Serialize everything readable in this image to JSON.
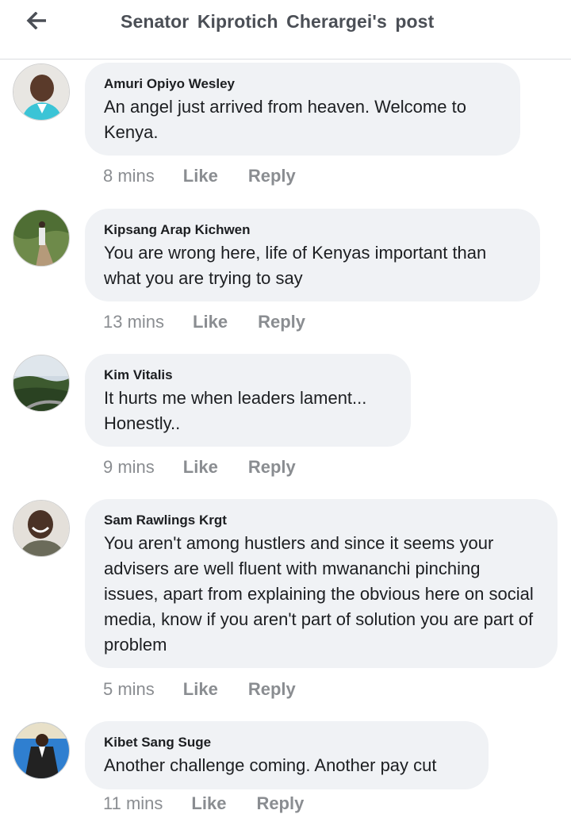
{
  "header": {
    "title": "Senator  Kiprotich  Cherargei's post",
    "back_icon": "back-arrow-icon"
  },
  "comments": [
    {
      "author": "Amuri Opiyo Wesley",
      "text": "An angel just arrived from heaven. Welcome to Kenya.",
      "time": "8 mins",
      "like": "Like",
      "reply": "Reply"
    },
    {
      "author": "Kipsang Arap Kichwen",
      "text": "You are wrong here, life of Kenyas important than what you are trying to say",
      "time": "13 mins",
      "like": "Like",
      "reply": "Reply"
    },
    {
      "author": "Kim Vitalis",
      "text": "It hurts me when leaders lament... Honestly..",
      "time": "9 mins",
      "like": "Like",
      "reply": "Reply"
    },
    {
      "author": "Sam Rawlings Krgt",
      "text": "You aren't among hustlers and since it seems your advisers are well fluent with mwananchi pinching issues, apart from explaining the obvious here on social media, know if you aren't part of solution you are part of problem",
      "time": "5 mins",
      "like": "Like",
      "reply": "Reply"
    },
    {
      "author": "Kibet Sang Suge",
      "text": "Another challenge coming. Another pay cut",
      "time": "11 mins",
      "like": "Like",
      "reply": "Reply"
    }
  ],
  "colors": {
    "bubble": "#f0f2f5",
    "meta": "#8a8d91",
    "title": "#4b4f56"
  }
}
